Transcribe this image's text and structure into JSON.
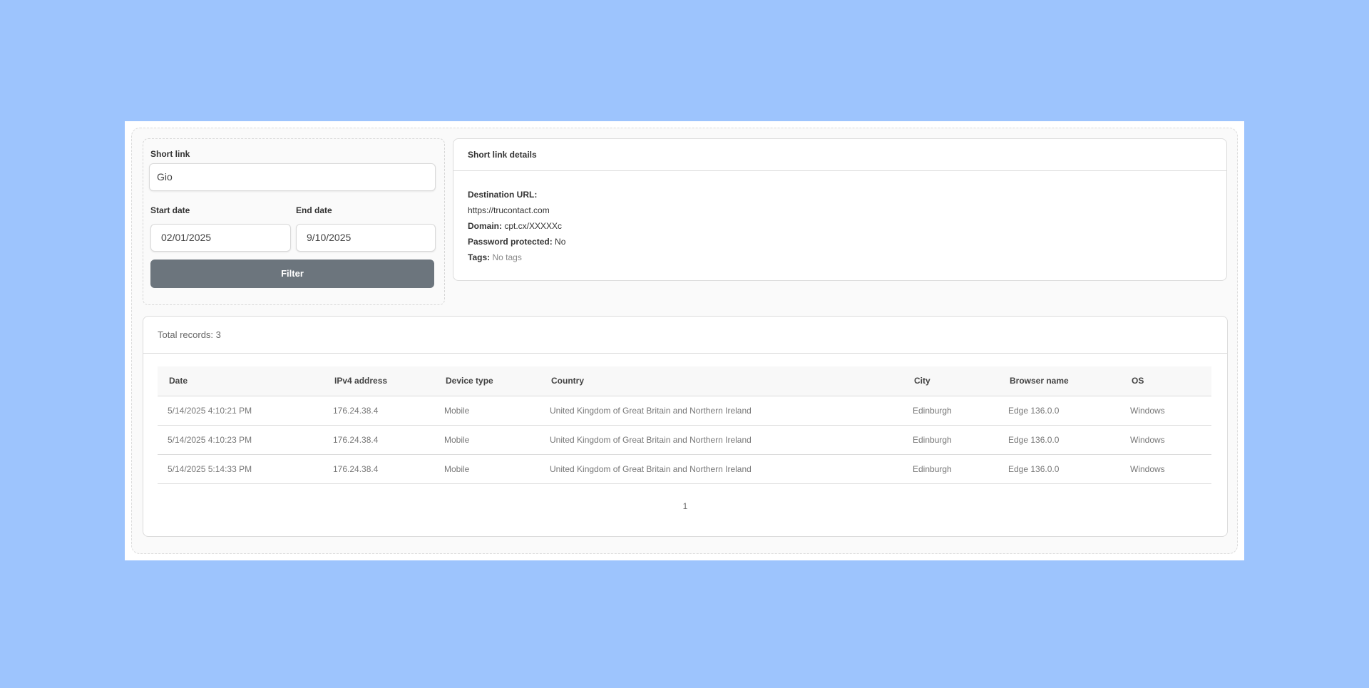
{
  "filter": {
    "short_link_label": "Short link",
    "short_link_value": "Gio",
    "start_date_label": "Start date",
    "start_date_value": "02/01/2025",
    "end_date_label": "End date",
    "end_date_value": "9/10/2025",
    "filter_button": "Filter"
  },
  "details": {
    "title": "Short link details",
    "destination_label": "Destination URL:",
    "destination_value": "https://trucontact.com",
    "domain_label": "Domain:",
    "domain_value": "cpt.cx/XXXXXc",
    "password_label": "Password protected:",
    "password_value": "No",
    "tags_label": "Tags:",
    "tags_value": "No tags"
  },
  "records": {
    "total_text": "Total records: 3",
    "columns": [
      "Date",
      "IPv4 address",
      "Device type",
      "Country",
      "City",
      "Browser name",
      "OS"
    ],
    "rows": [
      [
        "5/14/2025 4:10:21 PM",
        "176.24.38.4",
        "Mobile",
        "United Kingdom of Great Britain and Northern Ireland",
        "Edinburgh",
        "Edge 136.0.0",
        "Windows"
      ],
      [
        "5/14/2025 4:10:23 PM",
        "176.24.38.4",
        "Mobile",
        "United Kingdom of Great Britain and Northern Ireland",
        "Edinburgh",
        "Edge 136.0.0",
        "Windows"
      ],
      [
        "5/14/2025 5:14:33 PM",
        "176.24.38.4",
        "Mobile",
        "United Kingdom of Great Britain and Northern Ireland",
        "Edinburgh",
        "Edge 136.0.0",
        "Windows"
      ]
    ],
    "page": "1"
  },
  "colors": {
    "background": "#9dc4fd",
    "filter_button": "#6c757d"
  }
}
